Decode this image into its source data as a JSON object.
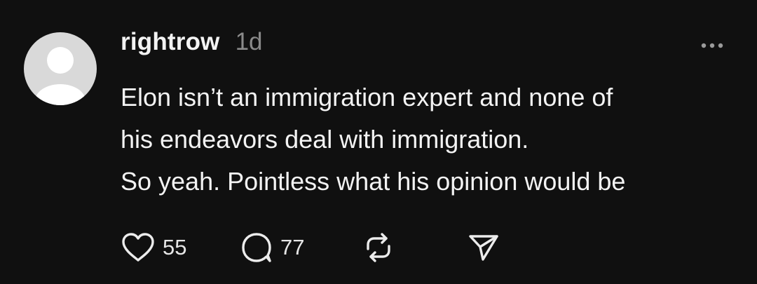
{
  "post": {
    "username": "rightrow",
    "timestamp": "1d",
    "text_lines": [
      "Elon isn’t an immigration expert and none of",
      "his endeavors deal with immigration.",
      "So yeah. Pointless what his opinion would be"
    ],
    "likes": "55",
    "replies": "77"
  },
  "icons": {
    "avatar": "default-avatar-icon",
    "more": "ellipsis-icon",
    "like": "heart-icon",
    "reply": "comment-bubble-icon",
    "repost": "repost-icon",
    "share": "send-icon"
  },
  "colors": {
    "background": "#101010",
    "text": "#f3f3f3",
    "muted": "#8a8a8a",
    "avatar": "#d9d9d9"
  }
}
